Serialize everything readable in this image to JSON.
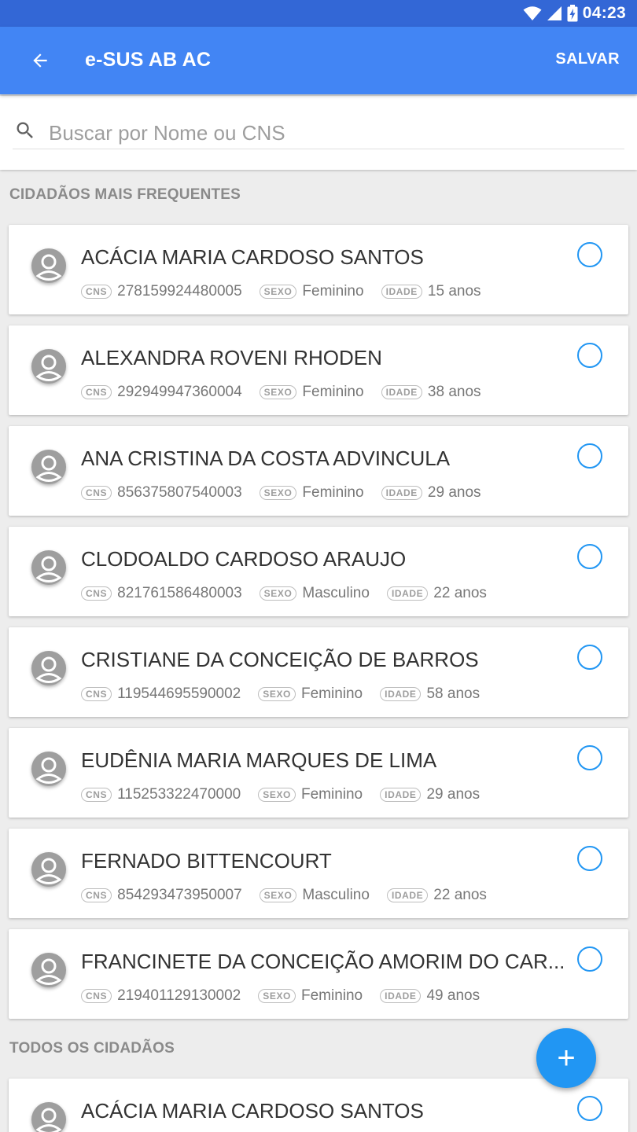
{
  "status_bar": {
    "time": "04:23",
    "icons": [
      "wifi-icon",
      "signal-icon",
      "battery-charging-icon"
    ]
  },
  "app_bar": {
    "back_icon": "arrow-back-icon",
    "title": "e-SUS AB AC",
    "save_label": "SALVAR"
  },
  "search": {
    "placeholder": "Buscar por Nome ou CNS",
    "icon": "search-icon"
  },
  "labels": {
    "cns": "CNS",
    "sexo": "SEXO",
    "idade": "IDADE"
  },
  "sections": {
    "frequent": {
      "title": "CIDADÃOS MAIS FREQUENTES",
      "citizens": [
        {
          "name": "ACÁCIA MARIA CARDOSO SANTOS",
          "cns": "278159924480005",
          "sexo": "Feminino",
          "idade": "15 anos"
        },
        {
          "name": "ALEXANDRA ROVENI RHODEN",
          "cns": "292949947360004",
          "sexo": "Feminino",
          "idade": "38 anos"
        },
        {
          "name": "ANA CRISTINA DA COSTA ADVINCULA",
          "cns": "856375807540003",
          "sexo": "Feminino",
          "idade": "29 anos"
        },
        {
          "name": "CLODOALDO CARDOSO ARAUJO",
          "cns": "821761586480003",
          "sexo": "Masculino",
          "idade": "22 anos"
        },
        {
          "name": "CRISTIANE DA CONCEIÇÃO DE BARROS",
          "cns": "119544695590002",
          "sexo": "Feminino",
          "idade": "58 anos"
        },
        {
          "name": "EUDÊNIA MARIA MARQUES DE LIMA",
          "cns": "115253322470000",
          "sexo": "Feminino",
          "idade": "29 anos"
        },
        {
          "name": "FERNADO BITTENCOURT",
          "cns": "854293473950007",
          "sexo": "Masculino",
          "idade": "22 anos"
        },
        {
          "name": "FRANCINETE DA CONCEIÇÃO AMORIM DO CAR...",
          "cns": "219401129130002",
          "sexo": "Feminino",
          "idade": "49 anos"
        }
      ]
    },
    "all": {
      "title": "TODOS OS CIDADÃOS",
      "citizens": [
        {
          "name": "ACÁCIA MARIA CARDOSO SANTOS"
        }
      ]
    }
  },
  "fab": {
    "label": "+",
    "icon": "add-icon"
  },
  "colors": {
    "status_bar": "#3367d6",
    "app_bar": "#4285f4",
    "accent": "#2196f3",
    "background": "#ededed"
  }
}
